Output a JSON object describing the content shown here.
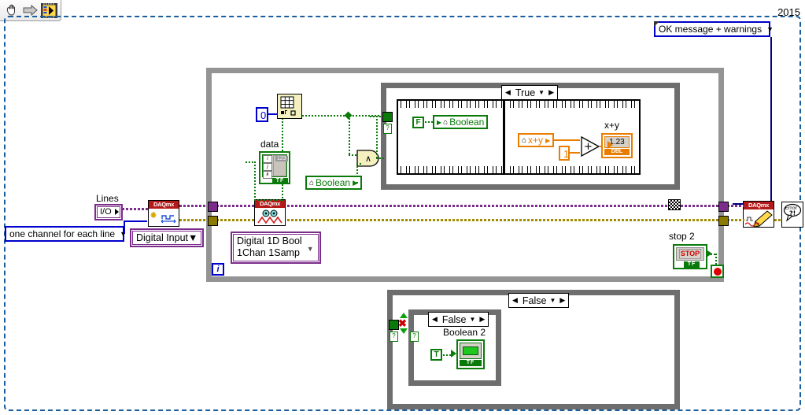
{
  "window": {
    "version_label": "2015",
    "toolbar": {
      "items": [
        {
          "name": "hand-tool-icon",
          "label": "Hand tool"
        },
        {
          "name": "arrow-right-icon",
          "label": "Run arrow"
        },
        {
          "name": "vi-icon",
          "label": "VI icon"
        }
      ]
    }
  },
  "error_handler": {
    "ring_label": "OK message + warnings"
  },
  "left_section": {
    "lines_label": "Lines",
    "io_constant": "I/O",
    "channel_mode_label": "one channel for each line",
    "digital_input_label": "Digital Input"
  },
  "read_node": {
    "read_mode_line1": "Digital 1D Bool",
    "read_mode_line2": "1Chan 1Samp"
  },
  "loop": {
    "iteration_label": "i",
    "stop_label": "stop 2",
    "stop_button_text": "STOP",
    "boolean_tag": "TF"
  },
  "data_cluster": {
    "data_label": "data",
    "index_constant": "0",
    "boolean_terminal": "Boolean",
    "array_indices": [
      "i",
      "j",
      "k"
    ],
    "array_type_tag": "123",
    "array_bool_tag": "TF"
  },
  "true_case": {
    "selector_label": "True",
    "left_frame": {
      "constant": "F",
      "boolean_terminal": "Boolean"
    },
    "right_frame": {
      "xy_terminal": "x+y",
      "numeric_constant": "1",
      "add_symbol": "+",
      "indicator_label": "x+y",
      "indicator_value": "1.23",
      "indicator_tag": "DBL"
    }
  },
  "false_case": {
    "outer_selector_label": "False",
    "inner_selector_label": "False",
    "indicator_label": "Boolean 2",
    "constant": "T",
    "indicator_tag": "TF"
  },
  "right_nodes": {
    "daqmx_write_label": "DAQmx",
    "error_node_line1": "Error",
    "error_node_line2": "?!"
  },
  "colors": {
    "wire_purple": "#7b2d8b",
    "wire_yellow": "#a08a00",
    "wire_green": "#0a7a0a",
    "wire_orange": "#e87d00",
    "accent_blue": "#0000cc",
    "diagram_border": "#1b5e9e",
    "loop_gray": "#949494",
    "daq_red": "#b51a1a"
  }
}
